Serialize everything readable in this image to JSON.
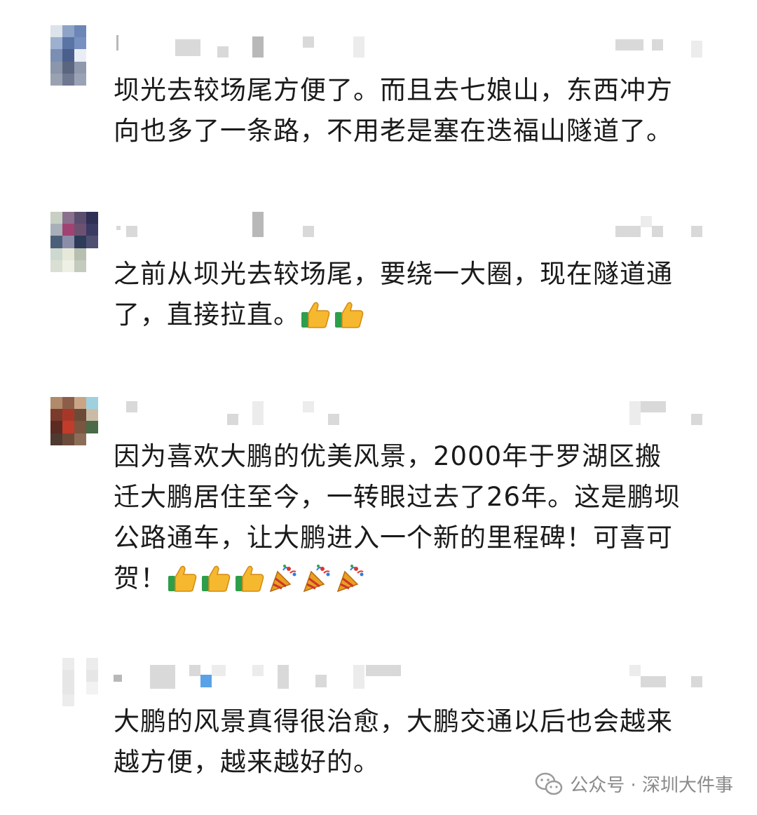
{
  "comments": [
    {
      "text": "坝光去较场尾方便了。而且去七娘山，东西冲方\n向也多了一条路，不用老是塞在迭福山隧道了。",
      "emojis": []
    },
    {
      "text": "之前从坝光去较场尾，要绕一大圈，现在隧道通\n了，直接拉直。",
      "emojis": [
        "thumbs-up",
        "thumbs-up"
      ]
    },
    {
      "text": "因为喜欢大鹏的优美风景，2000年于罗湖区搬\n迁大鹏居住至今，一转眼过去了26年。这是鹏坝\n公路通车，让大鹏进入一个新的里程碑！可喜可\n贺！",
      "emojis": [
        "thumbs-up",
        "thumbs-up",
        "thumbs-up",
        "party-popper",
        "party-popper",
        "party-popper"
      ]
    },
    {
      "text": "大鹏的风景真得很治愈，大鹏交通以后也会越来\n越方便，越来越好的。",
      "emojis": []
    }
  ],
  "footer": {
    "label": "公众号 · 深圳大件事",
    "icon": "wechat-icon"
  }
}
